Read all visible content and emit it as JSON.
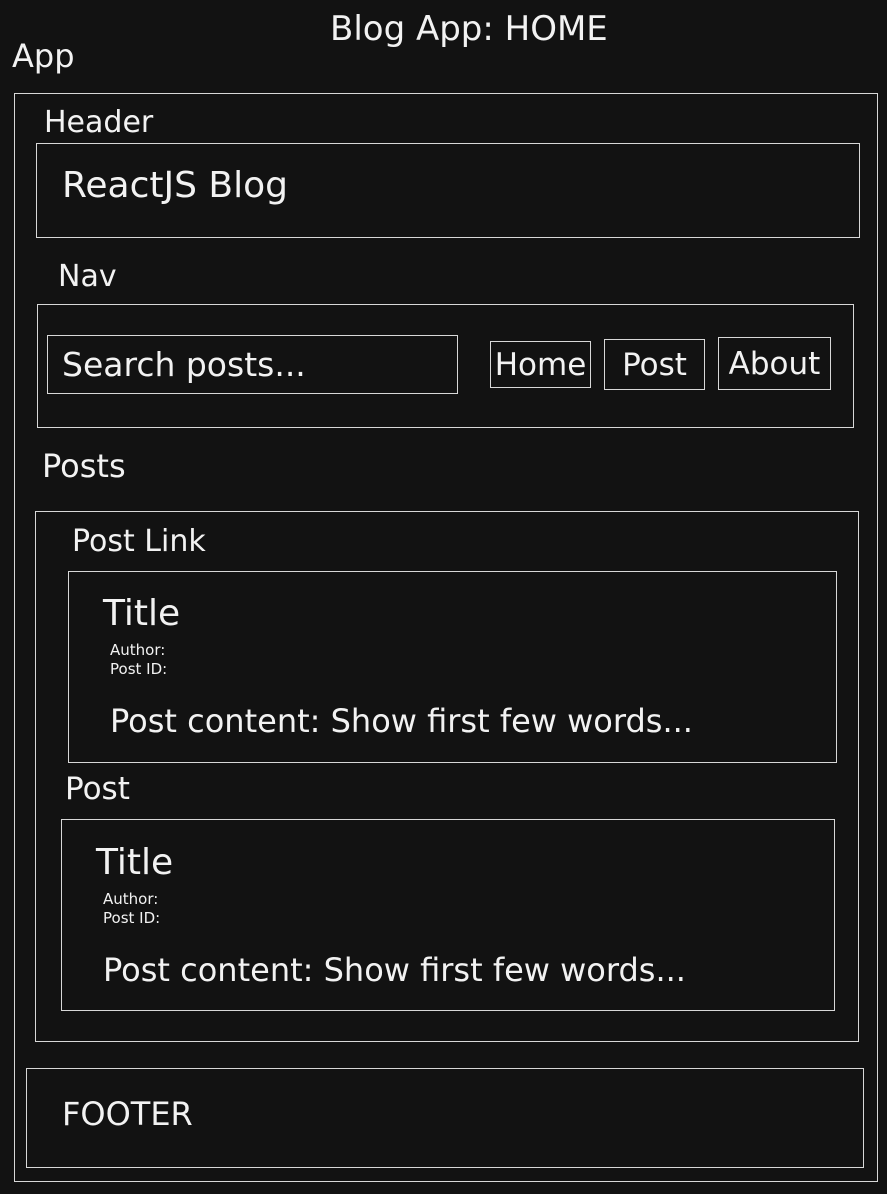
{
  "page_title": "Blog App: HOME",
  "app_label": "App",
  "header": {
    "label": "Header",
    "title": "ReactJS Blog"
  },
  "nav": {
    "label": "Nav",
    "search_placeholder": "Search posts...",
    "links": [
      "Home",
      "Post",
      "About"
    ]
  },
  "posts": {
    "label": "Posts",
    "post_link": {
      "label": "Post Link",
      "title": "Title",
      "author": "Author:",
      "post_id": "Post ID:",
      "content": "Post content: Show first few words..."
    },
    "post": {
      "label": "Post",
      "title": "Title",
      "author": "Author:",
      "post_id": "Post ID:",
      "content": "Post content: Show first few words..."
    }
  },
  "footer": {
    "text": "FOOTER"
  }
}
